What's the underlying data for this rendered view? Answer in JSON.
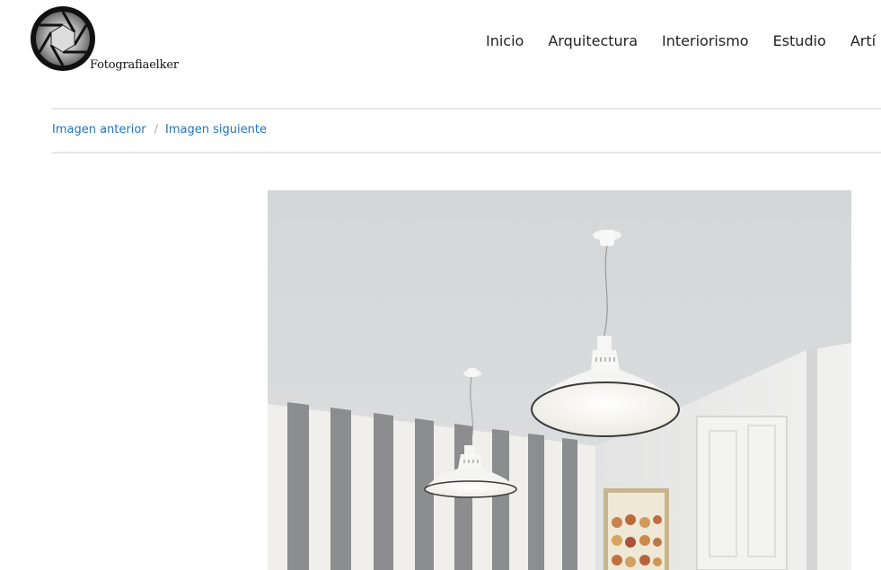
{
  "site": {
    "name": "Fotografiaelker"
  },
  "nav": {
    "items": [
      {
        "label": "Inicio"
      },
      {
        "label": "Arquitectura"
      },
      {
        "label": "Interiorismo"
      },
      {
        "label": "Estudio"
      },
      {
        "label": "Artí"
      }
    ]
  },
  "post_nav": {
    "previous": "Imagen anterior",
    "separator": "/",
    "next": "Imagen siguiente"
  },
  "colors": {
    "link": "#1e73be",
    "nav_text": "#222222",
    "rule": "#e6e6e6"
  }
}
